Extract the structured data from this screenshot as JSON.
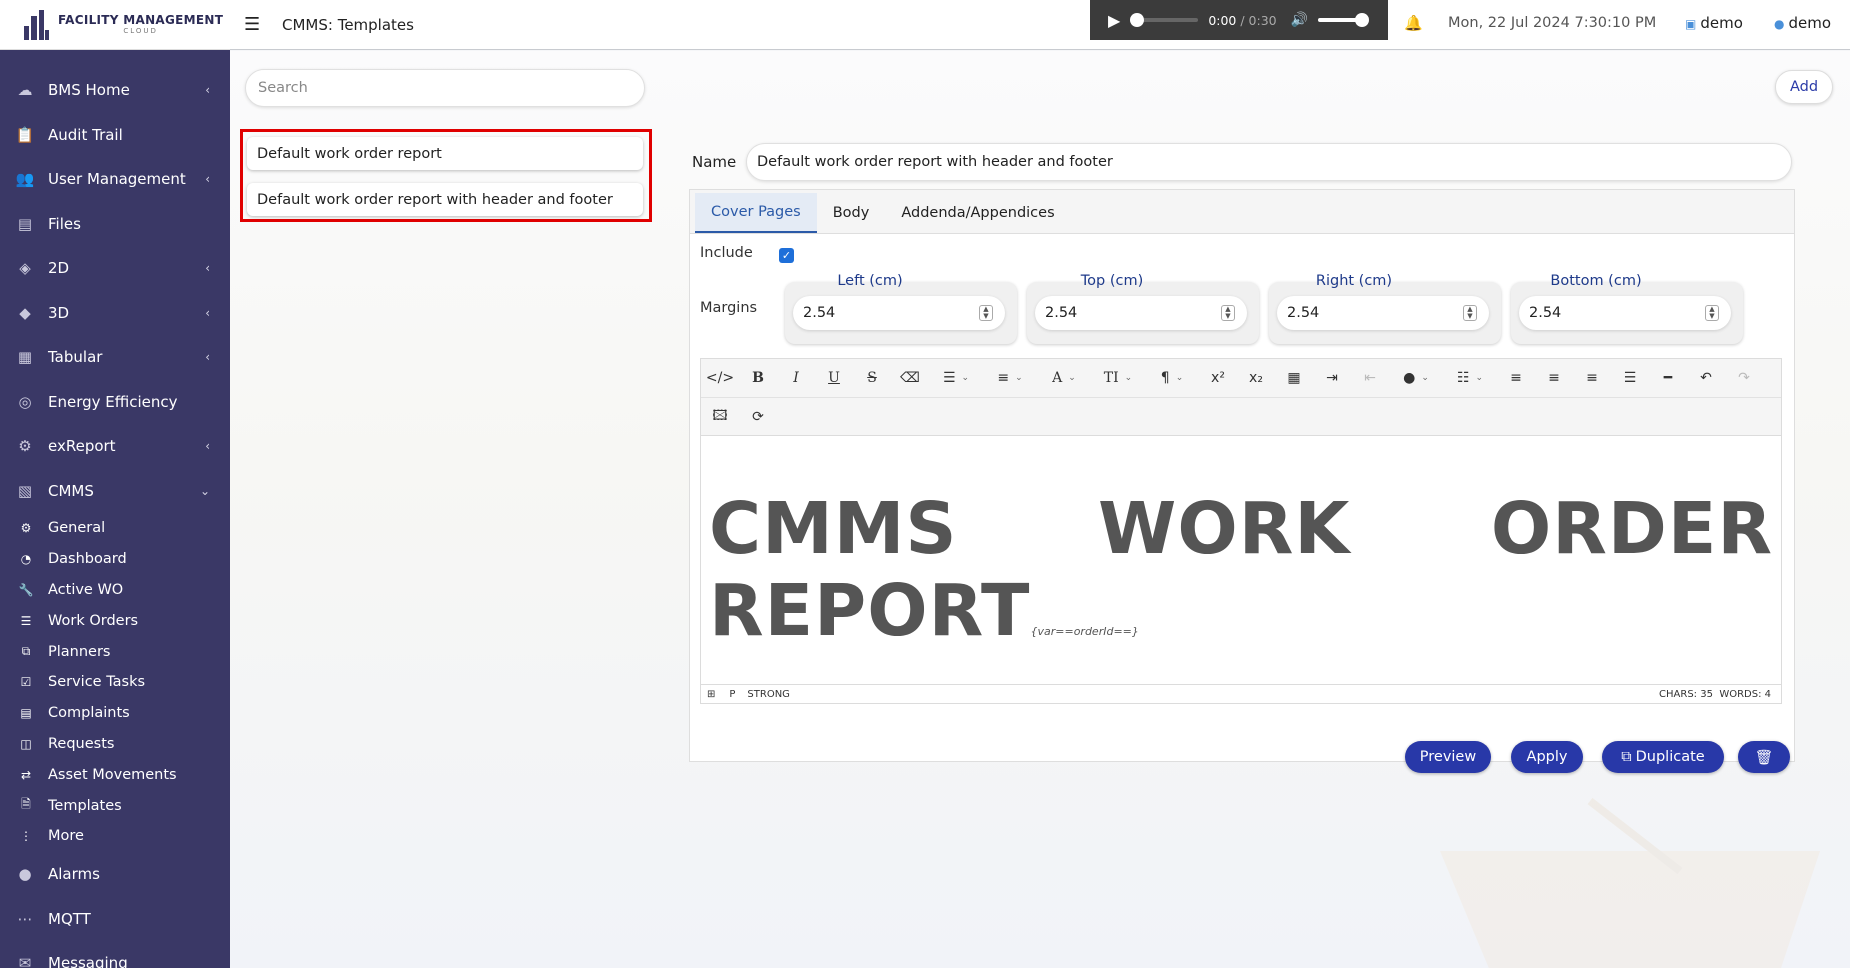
{
  "app": {
    "logo_line1": "FACILITY MANAGEMENT",
    "logo_line2": "CLOUD"
  },
  "sidebar": {
    "items": [
      {
        "label": "BMS Home",
        "icon": "cloud-home-icon",
        "chevron": true
      },
      {
        "label": "Audit Trail",
        "icon": "clipboard-icon",
        "chevron": false
      },
      {
        "label": "User Management",
        "icon": "users-icon",
        "chevron": true
      },
      {
        "label": "Files",
        "icon": "files-icon",
        "chevron": false
      },
      {
        "label": "2D",
        "icon": "layers-icon",
        "chevron": true
      },
      {
        "label": "3D",
        "icon": "cube-icon",
        "chevron": true
      },
      {
        "label": "Tabular",
        "icon": "table-icon",
        "chevron": true
      },
      {
        "label": "Energy Efficiency",
        "icon": "gauge-icon",
        "chevron": false
      },
      {
        "label": "exReport",
        "icon": "report-icon",
        "chevron": true
      },
      {
        "label": "CMMS",
        "icon": "cmms-icon",
        "chevron": true,
        "expanded": true
      }
    ],
    "cmms_sub": [
      {
        "label": "General",
        "icon": "gears-icon"
      },
      {
        "label": "Dashboard",
        "icon": "dashboard-icon"
      },
      {
        "label": "Active WO",
        "icon": "wrench-icon"
      },
      {
        "label": "Work Orders",
        "icon": "list-icon"
      },
      {
        "label": "Planners",
        "icon": "planner-icon"
      },
      {
        "label": "Service Tasks",
        "icon": "check-square-icon"
      },
      {
        "label": "Complaints",
        "icon": "complaint-icon"
      },
      {
        "label": "Requests",
        "icon": "request-icon"
      },
      {
        "label": "Asset Movements",
        "icon": "arrows-icon"
      },
      {
        "label": "Templates",
        "icon": "template-icon"
      },
      {
        "label": "More",
        "icon": "more-vertical-icon"
      }
    ],
    "bottom": [
      {
        "label": "Alarms",
        "icon": "alarm-icon"
      },
      {
        "label": "MQTT",
        "icon": "mqtt-icon"
      },
      {
        "label": "Messaging",
        "icon": "messaging-icon"
      }
    ]
  },
  "topbar": {
    "title": "CMMS: Templates",
    "audio_current": "0:00",
    "audio_duration": "/ 0:30",
    "datetime": "Mon, 22 Jul 2024 7:30:10 PM",
    "user1": "demo",
    "user2": "demo"
  },
  "search": {
    "placeholder": "Search"
  },
  "templates": [
    "Default work order report",
    "Default work order report with header and footer"
  ],
  "add_label": "Add",
  "form": {
    "name_label": "Name",
    "name_value": "Default work order report with header and footer",
    "tabs": [
      "Cover Pages",
      "Body",
      "Addenda/Appendices"
    ],
    "active_tab": "Cover Pages",
    "include_label": "Include",
    "include_checked": true,
    "margins_label": "Margins",
    "margins": [
      {
        "label": "Left (cm)",
        "value": "2.54"
      },
      {
        "label": "Top (cm)",
        "value": "2.54"
      },
      {
        "label": "Right (cm)",
        "value": "2.54"
      },
      {
        "label": "Bottom (cm)",
        "value": "2.54"
      }
    ]
  },
  "editor": {
    "content_main": "CMMS WORK ORDER REPORT",
    "content_var": "{var==orderId==}",
    "status_path": [
      "P",
      "STRONG"
    ],
    "chars": "CHARS: 35",
    "words": "WORDS: 4"
  },
  "actions": {
    "preview": "Preview",
    "apply": "Apply",
    "duplicate": "Duplicate"
  },
  "colors": {
    "sidebar": "#3a3866",
    "accent": "#2838a8",
    "highlight_border": "#e00000"
  }
}
